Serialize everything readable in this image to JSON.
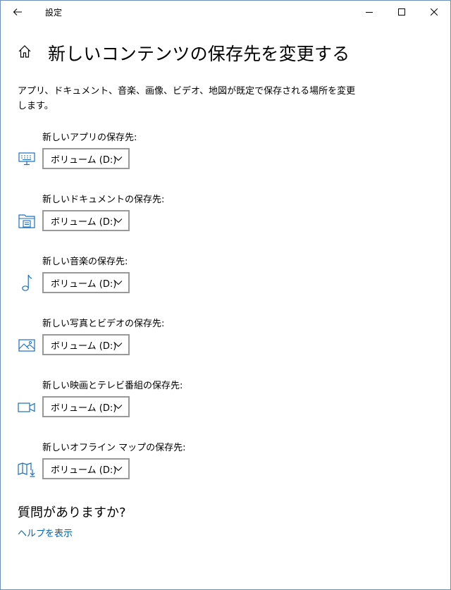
{
  "window": {
    "title": "設定",
    "back_icon": "back-arrow-icon",
    "controls": [
      "minimize-icon",
      "maximize-icon",
      "close-icon"
    ]
  },
  "page": {
    "title": "新しいコンテンツの保存先を変更する",
    "description": "アプリ、ドキュメント、音楽、画像、ビデオ、地図が既定で保存される場所を変更します。"
  },
  "rows": [
    {
      "label": "新しいアプリの保存先:",
      "value": "ボリューム (D:)",
      "icon": "monitor-keyboard-icon"
    },
    {
      "label": "新しいドキュメントの保存先:",
      "value": "ボリューム (D:)",
      "icon": "folder-documents-icon"
    },
    {
      "label": "新しい音楽の保存先:",
      "value": "ボリューム (D:)",
      "icon": "music-note-icon"
    },
    {
      "label": "新しい写真とビデオの保存先:",
      "value": "ボリューム (D:)",
      "icon": "picture-icon"
    },
    {
      "label": "新しい映画とテレビ番組の保存先:",
      "value": "ボリューム (D:)",
      "icon": "video-camera-icon"
    },
    {
      "label": "新しいオフライン マップの保存先:",
      "value": "ボリューム (D:)",
      "icon": "map-download-icon"
    }
  ],
  "help": {
    "heading": "質問がありますか?",
    "link": "ヘルプを表示"
  },
  "colors": {
    "accent": "#0063b1",
    "icon_blue": "#1a6fc2",
    "dropdown_border": "#999999"
  }
}
